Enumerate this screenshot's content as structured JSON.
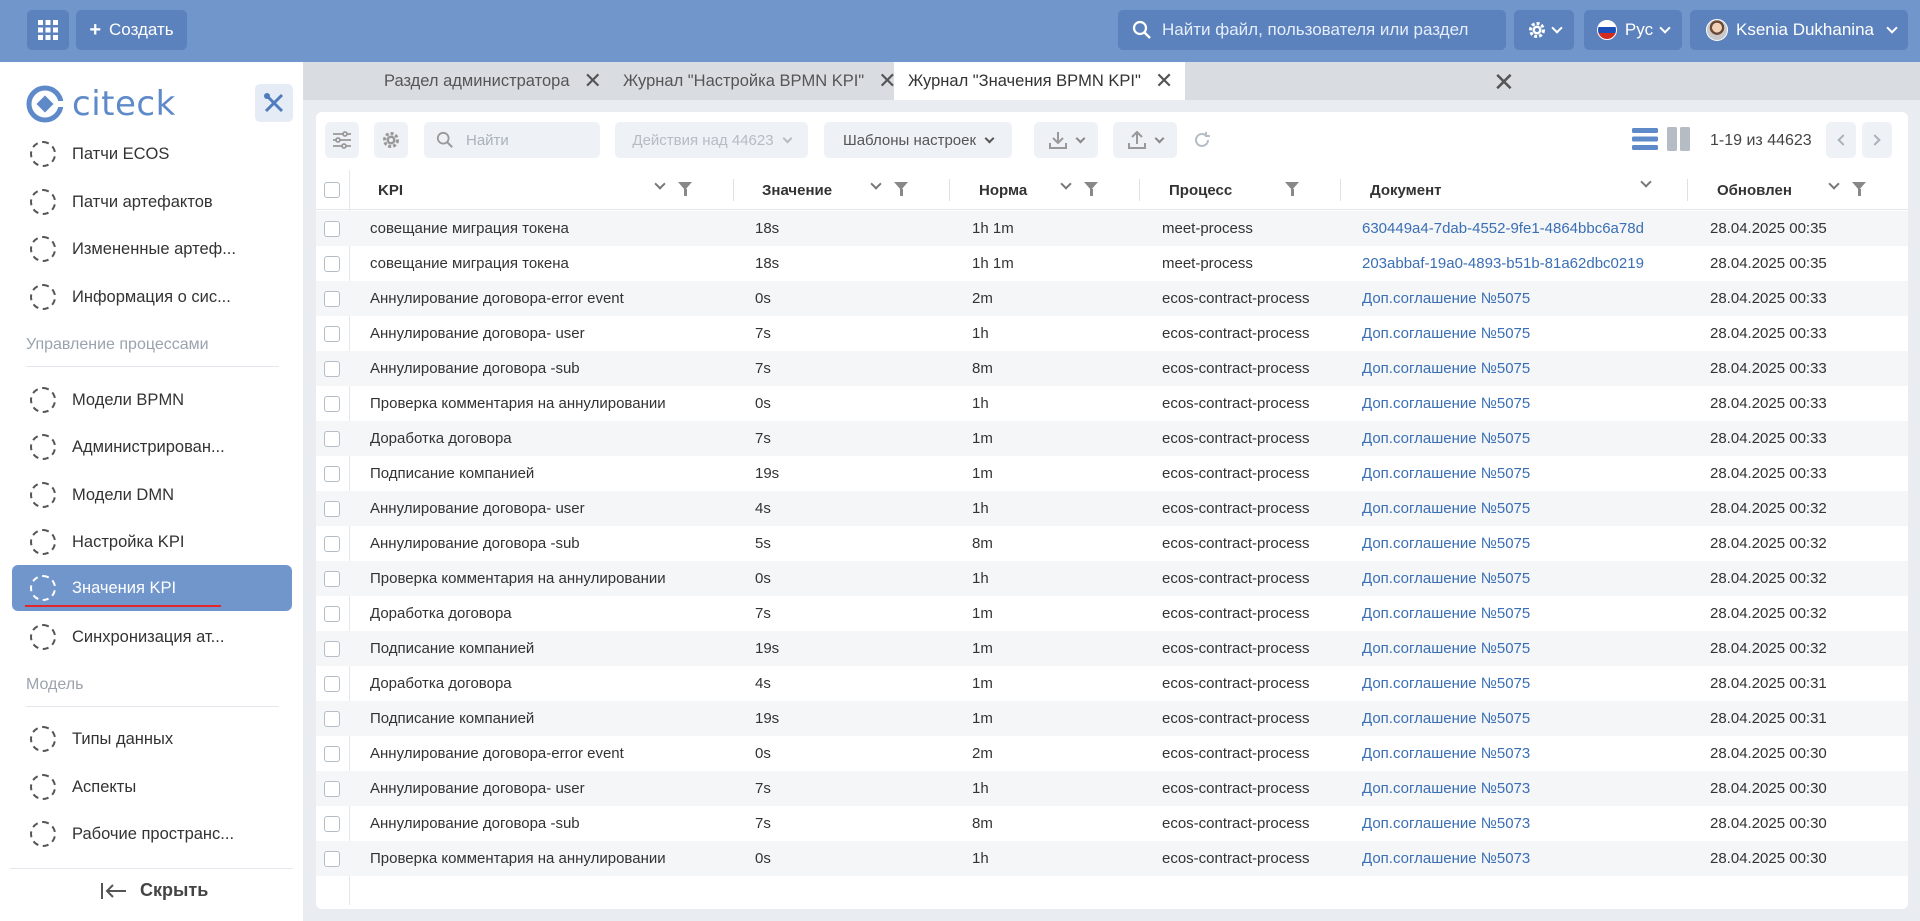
{
  "header": {
    "create_label": "Создать",
    "search_placeholder": "Найти файл, пользователя или раздел",
    "lang_label": "Рус",
    "user_name": "Ksenia Dukhanina"
  },
  "sidebar": {
    "logo_text": "citeck",
    "items_top": [
      {
        "label": "Патчи ECOS"
      },
      {
        "label": "Патчи артефактов"
      },
      {
        "label": "Измененные артеф..."
      },
      {
        "label": "Информация о сис..."
      }
    ],
    "section_process": "Управление процессами",
    "items_process": [
      {
        "label": "Модели BPMN"
      },
      {
        "label": "Администрирован..."
      },
      {
        "label": "Модели DMN"
      },
      {
        "label": "Настройка KPI"
      },
      {
        "label": "Значения KPI"
      },
      {
        "label": "Синхронизация ат..."
      }
    ],
    "section_model": "Модель",
    "items_model": [
      {
        "label": "Типы данных"
      },
      {
        "label": "Аспекты"
      },
      {
        "label": "Рабочие пространс..."
      }
    ],
    "hide_label": "Скрыть"
  },
  "tabs": [
    {
      "label": "Раздел администратора"
    },
    {
      "label": "Журнал \"Настройка BPMN KPI\""
    },
    {
      "label": "Журнал \"Значения BPMN KPI\""
    }
  ],
  "toolbar": {
    "search_placeholder": "Найти",
    "actions_label": "Действия над 44623",
    "templates_label": "Шаблоны настроек",
    "pager_text": "1-19 из 44623"
  },
  "table": {
    "columns": [
      "KPI",
      "Значение",
      "Норма",
      "Процесс",
      "Документ",
      "Обновлен"
    ],
    "rows": [
      [
        "совещание миграция токена",
        "18s",
        "1h 1m",
        "meet-process",
        "630449a4-7dab-4552-9fe1-4864bbc6a78d",
        "28.04.2025 00:35"
      ],
      [
        "совещание миграция токена",
        "18s",
        "1h 1m",
        "meet-process",
        "203abbaf-19a0-4893-b51b-81a62dbc0219",
        "28.04.2025 00:35"
      ],
      [
        "Аннулирование договора-error event",
        "0s",
        "2m",
        "ecos-contract-process",
        "Доп.соглашение №5075",
        "28.04.2025 00:33"
      ],
      [
        "Аннулирование договора- user",
        "7s",
        "1h",
        "ecos-contract-process",
        "Доп.соглашение №5075",
        "28.04.2025 00:33"
      ],
      [
        "Аннулирование договора -sub",
        "7s",
        "8m",
        "ecos-contract-process",
        "Доп.соглашение №5075",
        "28.04.2025 00:33"
      ],
      [
        "Проверка комментария на аннулировании",
        "0s",
        "1h",
        "ecos-contract-process",
        "Доп.соглашение №5075",
        "28.04.2025 00:33"
      ],
      [
        "Доработка договора",
        "7s",
        "1m",
        "ecos-contract-process",
        "Доп.соглашение №5075",
        "28.04.2025 00:33"
      ],
      [
        "Подписание компанией",
        "19s",
        "1m",
        "ecos-contract-process",
        "Доп.соглашение №5075",
        "28.04.2025 00:33"
      ],
      [
        "Аннулирование договора- user",
        "4s",
        "1h",
        "ecos-contract-process",
        "Доп.соглашение №5075",
        "28.04.2025 00:32"
      ],
      [
        "Аннулирование договора -sub",
        "5s",
        "8m",
        "ecos-contract-process",
        "Доп.соглашение №5075",
        "28.04.2025 00:32"
      ],
      [
        "Проверка комментария на аннулировании",
        "0s",
        "1h",
        "ecos-contract-process",
        "Доп.соглашение №5075",
        "28.04.2025 00:32"
      ],
      [
        "Доработка договора",
        "7s",
        "1m",
        "ecos-contract-process",
        "Доп.соглашение №5075",
        "28.04.2025 00:32"
      ],
      [
        "Подписание компанией",
        "19s",
        "1m",
        "ecos-contract-process",
        "Доп.соглашение №5075",
        "28.04.2025 00:32"
      ],
      [
        "Доработка договора",
        "4s",
        "1m",
        "ecos-contract-process",
        "Доп.соглашение №5075",
        "28.04.2025 00:31"
      ],
      [
        "Подписание компанией",
        "19s",
        "1m",
        "ecos-contract-process",
        "Доп.соглашение №5075",
        "28.04.2025 00:31"
      ],
      [
        "Аннулирование договора-error event",
        "0s",
        "2m",
        "ecos-contract-process",
        "Доп.соглашение №5073",
        "28.04.2025 00:30"
      ],
      [
        "Аннулирование договора- user",
        "7s",
        "1h",
        "ecos-contract-process",
        "Доп.соглашение №5073",
        "28.04.2025 00:30"
      ],
      [
        "Аннулирование договора -sub",
        "7s",
        "8m",
        "ecos-contract-process",
        "Доп.соглашение №5073",
        "28.04.2025 00:30"
      ],
      [
        "Проверка комментария на аннулировании",
        "0s",
        "1h",
        "ecos-contract-process",
        "Доп.соглашение №5073",
        "28.04.2025 00:30"
      ]
    ]
  },
  "colors": {
    "accent": "#7096cc",
    "link": "#3a6fb5",
    "active_underline": "#e3262c"
  }
}
